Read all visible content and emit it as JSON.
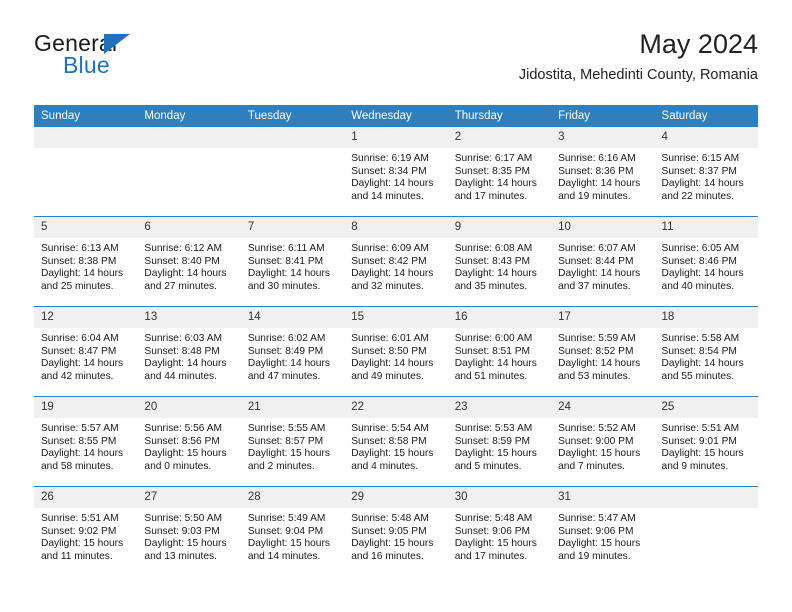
{
  "brand": {
    "name_top": "General",
    "name_bottom": "Blue",
    "accent_color": "#1f72bd"
  },
  "header": {
    "title": "May 2024",
    "subtitle": "Jidostita, Mehedinti County, Romania"
  },
  "theme": {
    "header_row_color": "#2f7ebd",
    "daynum_background": "#f0f0f0",
    "cell_background": "#ffffff",
    "text_color": "#1a1a1a"
  },
  "weekday_headers": [
    "Sunday",
    "Monday",
    "Tuesday",
    "Wednesday",
    "Thursday",
    "Friday",
    "Saturday"
  ],
  "labels": {
    "sunrise_prefix": "Sunrise: ",
    "sunset_prefix": "Sunset: ",
    "daylight_prefix": "Daylight: "
  },
  "weeks": [
    [
      {
        "day": "",
        "blank": true,
        "line1": "",
        "line2": "",
        "line3": "",
        "line4": ""
      },
      {
        "day": "",
        "blank": true,
        "line1": "",
        "line2": "",
        "line3": "",
        "line4": ""
      },
      {
        "day": "",
        "blank": true,
        "line1": "",
        "line2": "",
        "line3": "",
        "line4": ""
      },
      {
        "day": "1",
        "blank": false,
        "line1": "Sunrise: 6:19 AM",
        "line2": "Sunset: 8:34 PM",
        "line3": "Daylight: 14 hours",
        "line4": "and 14 minutes."
      },
      {
        "day": "2",
        "blank": false,
        "line1": "Sunrise: 6:17 AM",
        "line2": "Sunset: 8:35 PM",
        "line3": "Daylight: 14 hours",
        "line4": "and 17 minutes."
      },
      {
        "day": "3",
        "blank": false,
        "line1": "Sunrise: 6:16 AM",
        "line2": "Sunset: 8:36 PM",
        "line3": "Daylight: 14 hours",
        "line4": "and 19 minutes."
      },
      {
        "day": "4",
        "blank": false,
        "line1": "Sunrise: 6:15 AM",
        "line2": "Sunset: 8:37 PM",
        "line3": "Daylight: 14 hours",
        "line4": "and 22 minutes."
      }
    ],
    [
      {
        "day": "5",
        "blank": false,
        "line1": "Sunrise: 6:13 AM",
        "line2": "Sunset: 8:38 PM",
        "line3": "Daylight: 14 hours",
        "line4": "and 25 minutes."
      },
      {
        "day": "6",
        "blank": false,
        "line1": "Sunrise: 6:12 AM",
        "line2": "Sunset: 8:40 PM",
        "line3": "Daylight: 14 hours",
        "line4": "and 27 minutes."
      },
      {
        "day": "7",
        "blank": false,
        "line1": "Sunrise: 6:11 AM",
        "line2": "Sunset: 8:41 PM",
        "line3": "Daylight: 14 hours",
        "line4": "and 30 minutes."
      },
      {
        "day": "8",
        "blank": false,
        "line1": "Sunrise: 6:09 AM",
        "line2": "Sunset: 8:42 PM",
        "line3": "Daylight: 14 hours",
        "line4": "and 32 minutes."
      },
      {
        "day": "9",
        "blank": false,
        "line1": "Sunrise: 6:08 AM",
        "line2": "Sunset: 8:43 PM",
        "line3": "Daylight: 14 hours",
        "line4": "and 35 minutes."
      },
      {
        "day": "10",
        "blank": false,
        "line1": "Sunrise: 6:07 AM",
        "line2": "Sunset: 8:44 PM",
        "line3": "Daylight: 14 hours",
        "line4": "and 37 minutes."
      },
      {
        "day": "11",
        "blank": false,
        "line1": "Sunrise: 6:05 AM",
        "line2": "Sunset: 8:46 PM",
        "line3": "Daylight: 14 hours",
        "line4": "and 40 minutes."
      }
    ],
    [
      {
        "day": "12",
        "blank": false,
        "line1": "Sunrise: 6:04 AM",
        "line2": "Sunset: 8:47 PM",
        "line3": "Daylight: 14 hours",
        "line4": "and 42 minutes."
      },
      {
        "day": "13",
        "blank": false,
        "line1": "Sunrise: 6:03 AM",
        "line2": "Sunset: 8:48 PM",
        "line3": "Daylight: 14 hours",
        "line4": "and 44 minutes."
      },
      {
        "day": "14",
        "blank": false,
        "line1": "Sunrise: 6:02 AM",
        "line2": "Sunset: 8:49 PM",
        "line3": "Daylight: 14 hours",
        "line4": "and 47 minutes."
      },
      {
        "day": "15",
        "blank": false,
        "line1": "Sunrise: 6:01 AM",
        "line2": "Sunset: 8:50 PM",
        "line3": "Daylight: 14 hours",
        "line4": "and 49 minutes."
      },
      {
        "day": "16",
        "blank": false,
        "line1": "Sunrise: 6:00 AM",
        "line2": "Sunset: 8:51 PM",
        "line3": "Daylight: 14 hours",
        "line4": "and 51 minutes."
      },
      {
        "day": "17",
        "blank": false,
        "line1": "Sunrise: 5:59 AM",
        "line2": "Sunset: 8:52 PM",
        "line3": "Daylight: 14 hours",
        "line4": "and 53 minutes."
      },
      {
        "day": "18",
        "blank": false,
        "line1": "Sunrise: 5:58 AM",
        "line2": "Sunset: 8:54 PM",
        "line3": "Daylight: 14 hours",
        "line4": "and 55 minutes."
      }
    ],
    [
      {
        "day": "19",
        "blank": false,
        "line1": "Sunrise: 5:57 AM",
        "line2": "Sunset: 8:55 PM",
        "line3": "Daylight: 14 hours",
        "line4": "and 58 minutes."
      },
      {
        "day": "20",
        "blank": false,
        "line1": "Sunrise: 5:56 AM",
        "line2": "Sunset: 8:56 PM",
        "line3": "Daylight: 15 hours",
        "line4": "and 0 minutes."
      },
      {
        "day": "21",
        "blank": false,
        "line1": "Sunrise: 5:55 AM",
        "line2": "Sunset: 8:57 PM",
        "line3": "Daylight: 15 hours",
        "line4": "and 2 minutes."
      },
      {
        "day": "22",
        "blank": false,
        "line1": "Sunrise: 5:54 AM",
        "line2": "Sunset: 8:58 PM",
        "line3": "Daylight: 15 hours",
        "line4": "and 4 minutes."
      },
      {
        "day": "23",
        "blank": false,
        "line1": "Sunrise: 5:53 AM",
        "line2": "Sunset: 8:59 PM",
        "line3": "Daylight: 15 hours",
        "line4": "and 5 minutes."
      },
      {
        "day": "24",
        "blank": false,
        "line1": "Sunrise: 5:52 AM",
        "line2": "Sunset: 9:00 PM",
        "line3": "Daylight: 15 hours",
        "line4": "and 7 minutes."
      },
      {
        "day": "25",
        "blank": false,
        "line1": "Sunrise: 5:51 AM",
        "line2": "Sunset: 9:01 PM",
        "line3": "Daylight: 15 hours",
        "line4": "and 9 minutes."
      }
    ],
    [
      {
        "day": "26",
        "blank": false,
        "line1": "Sunrise: 5:51 AM",
        "line2": "Sunset: 9:02 PM",
        "line3": "Daylight: 15 hours",
        "line4": "and 11 minutes."
      },
      {
        "day": "27",
        "blank": false,
        "line1": "Sunrise: 5:50 AM",
        "line2": "Sunset: 9:03 PM",
        "line3": "Daylight: 15 hours",
        "line4": "and 13 minutes."
      },
      {
        "day": "28",
        "blank": false,
        "line1": "Sunrise: 5:49 AM",
        "line2": "Sunset: 9:04 PM",
        "line3": "Daylight: 15 hours",
        "line4": "and 14 minutes."
      },
      {
        "day": "29",
        "blank": false,
        "line1": "Sunrise: 5:48 AM",
        "line2": "Sunset: 9:05 PM",
        "line3": "Daylight: 15 hours",
        "line4": "and 16 minutes."
      },
      {
        "day": "30",
        "blank": false,
        "line1": "Sunrise: 5:48 AM",
        "line2": "Sunset: 9:06 PM",
        "line3": "Daylight: 15 hours",
        "line4": "and 17 minutes."
      },
      {
        "day": "31",
        "blank": false,
        "line1": "Sunrise: 5:47 AM",
        "line2": "Sunset: 9:06 PM",
        "line3": "Daylight: 15 hours",
        "line4": "and 19 minutes."
      },
      {
        "day": "",
        "blank": true,
        "line1": "",
        "line2": "",
        "line3": "",
        "line4": ""
      }
    ]
  ]
}
